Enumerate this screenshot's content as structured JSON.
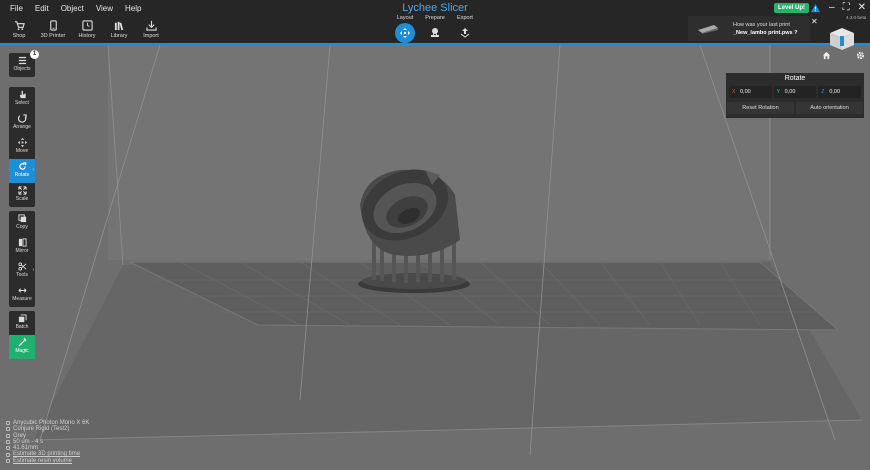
{
  "menu": {
    "file": "File",
    "edit": "Edit",
    "object": "Object",
    "view": "View",
    "help": "Help"
  },
  "app_title": "Lychee Slicer",
  "toolbar": {
    "shop": "Shop",
    "printer": "3D Printer",
    "history": "History",
    "library": "Library",
    "import": "Import"
  },
  "modes": {
    "layout": "Layout",
    "prepare": "Prepare",
    "export": "Export"
  },
  "level_up": "Level Up!",
  "notification": {
    "question": "How was your last print",
    "file": "_New_lambo print.pws ?"
  },
  "version": "4.3.0-beta",
  "sidebar": {
    "objects": "Objects",
    "objects_count": "1",
    "select": "Select",
    "arrange": "Arrange",
    "move": "Move",
    "rotate": "Rotate",
    "scale": "Scale",
    "copy": "Copy",
    "mirror": "Mirror",
    "tools": "Tools",
    "measure": "Measure",
    "batch": "Batch",
    "magic": "Magic"
  },
  "rotate_panel": {
    "title": "Rotate",
    "x_label": "X",
    "x_value": "0,00",
    "y_label": "Y",
    "y_value": "0,00",
    "z_label": "Z",
    "z_value": "0,00",
    "reset": "Reset Rotation",
    "auto": "Auto orientation"
  },
  "info": {
    "printer": "Anycubic Photon Mono X 6K",
    "resin": "Conjure Rigid (Test2)",
    "color": "Grey",
    "layer": "50 um - 4 s",
    "height": "41.61mm",
    "estimate_time": "Estimate 3D printing time",
    "estimate_resin": "Estimate resin volume"
  },
  "colors": {
    "accent": "#1e8fd6",
    "magic": "#22b071",
    "topbar": "#262626",
    "viewport": "#6e6e6e"
  }
}
